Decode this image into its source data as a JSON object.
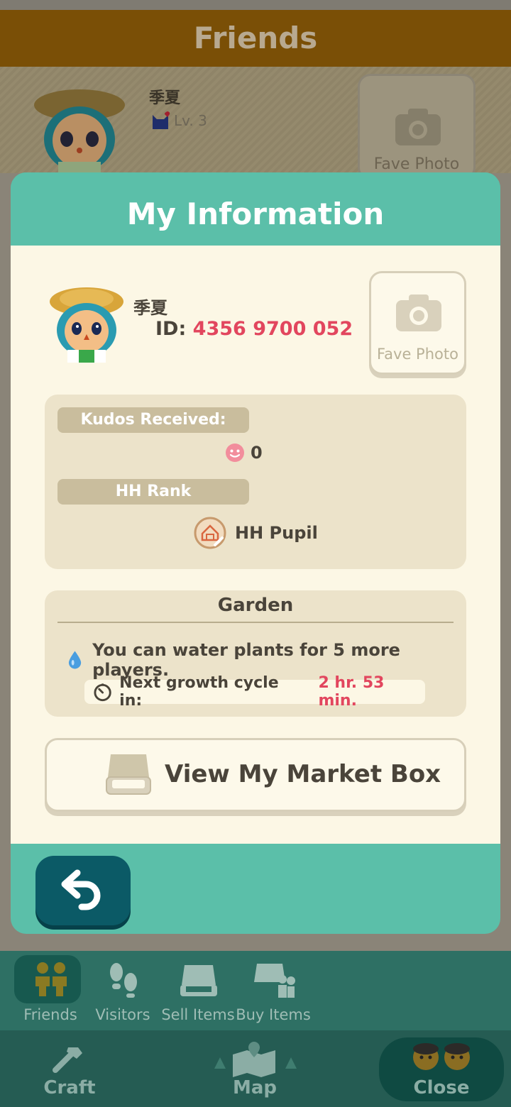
{
  "background": {
    "header_title": "Friends",
    "player_name": "季夏",
    "player_level": "Lv. 3",
    "fave_photo_label": "Fave Photo"
  },
  "modal": {
    "title": "My Information",
    "name": "季夏",
    "id_label": "ID:",
    "id_value": "4356 9700 052",
    "fave_photo_label": "Fave Photo",
    "kudos_label": "Kudos Received:",
    "kudos_value": "0",
    "rank_label": "HH Rank",
    "rank_value": "HH Pupil",
    "garden": {
      "title": "Garden",
      "message": "You can water plants for 5 more players.",
      "growth_label": "Next growth cycle in:",
      "growth_time": "2 hr. 53 min."
    },
    "market_box_label": "View My Market Box"
  },
  "subnav": [
    {
      "label": "Friends",
      "icon": "friends-icon"
    },
    {
      "label": "Visitors",
      "icon": "footprints-icon"
    },
    {
      "label": "Sell Items",
      "icon": "market-box-icon"
    },
    {
      "label": "Buy Items",
      "icon": "buy-items-icon"
    }
  ],
  "mainnav": [
    {
      "label": "Craft",
      "icon": "hammer-icon"
    },
    {
      "label": "Map",
      "icon": "map-icon"
    },
    {
      "label": "Close",
      "icon": "villagers-icon"
    }
  ],
  "colors": {
    "accent_teal": "#5bbfa9",
    "highlight_red": "#e2465e",
    "panel_cream": "#fcf7e5",
    "back_button": "#0b5a66"
  }
}
